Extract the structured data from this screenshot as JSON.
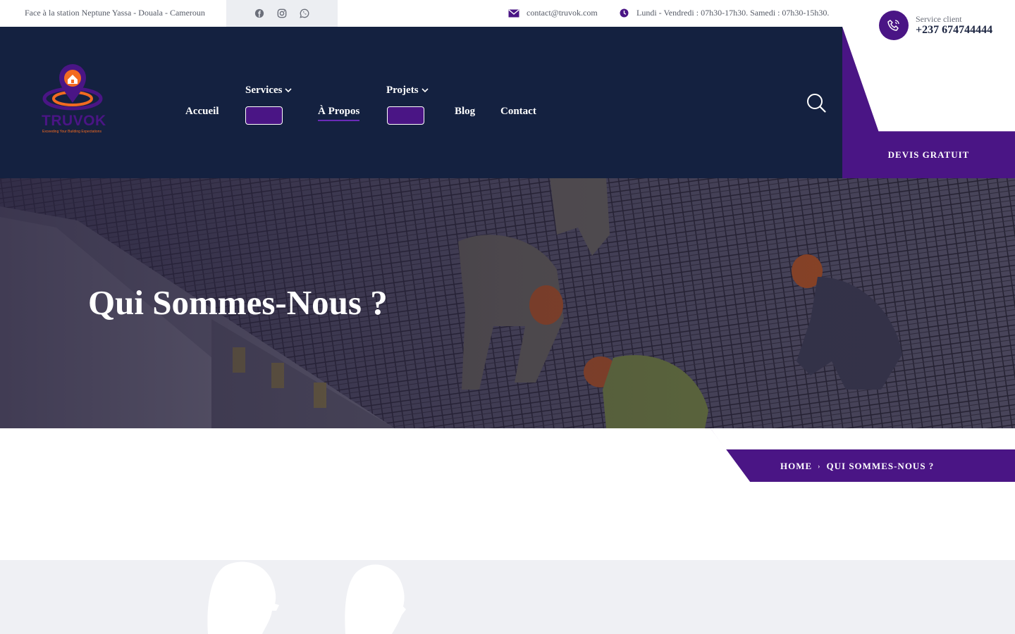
{
  "topbar": {
    "address": "Face à la station Neptune Yassa - Douala - Cameroun",
    "social": [
      "facebook-icon",
      "instagram-icon",
      "whatsapp-icon"
    ],
    "email": "contact@truvok.com",
    "hours": "Lundi - Vendredi : 07h30-17h30. Samedi : 07h30-15h30."
  },
  "service_client": {
    "label": "Service client",
    "number": "+237 674744444"
  },
  "brand": {
    "name": "TRUVOK",
    "tagline": "Exceeding Your Building Expectations"
  },
  "nav": {
    "items": [
      {
        "label": "Accueil"
      },
      {
        "label": "Services",
        "chevron": "⌄"
      },
      {
        "label": "À Propos"
      },
      {
        "label": "Projets",
        "chevron": "⌄"
      },
      {
        "label": "Blog"
      },
      {
        "label": "Contact"
      }
    ]
  },
  "cta": {
    "devis": "DEVIS GRATUIT"
  },
  "hero": {
    "title": "Qui Sommes-Nous ?"
  },
  "breadcrumb": {
    "home": "HOME",
    "separator": "›",
    "current": "QUI SOMMES-NOUS ?"
  },
  "colors": {
    "navy": "#142140",
    "purple": "#4a1585",
    "light_bg": "#eff0f4"
  }
}
